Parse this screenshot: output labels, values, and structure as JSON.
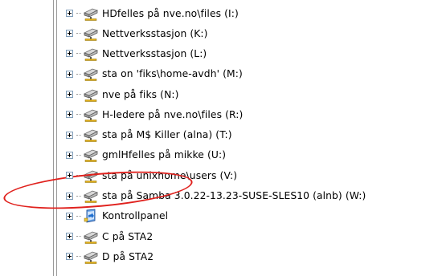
{
  "tree": {
    "items": [
      {
        "label": "HDfelles på nve.no\\files (I:)",
        "icon": "network-drive-icon"
      },
      {
        "label": "Nettverksstasjon (K:)",
        "icon": "network-drive-icon"
      },
      {
        "label": "Nettverksstasjon (L:)",
        "icon": "network-drive-icon"
      },
      {
        "label": "sta on 'fiks\\home-avdh' (M:)",
        "icon": "network-drive-icon"
      },
      {
        "label": "nve på fiks (N:)",
        "icon": "network-drive-icon"
      },
      {
        "label": "H-ledere på nve.no\\files (R:)",
        "icon": "network-drive-icon"
      },
      {
        "label": "sta på M$ Killer (alna) (T:)",
        "icon": "network-drive-icon"
      },
      {
        "label": "gmlHfelles på mikke (U:)",
        "icon": "network-drive-icon"
      },
      {
        "label": "sta på unixhome\\users (V:)",
        "icon": "network-drive-icon"
      },
      {
        "label": "sta på Samba 3.0.22-13.23-SUSE-SLES10 (alnb) (W:)",
        "icon": "network-drive-icon"
      },
      {
        "label": "Kontrollpanel",
        "icon": "control-panel-icon"
      },
      {
        "label": "C på STA2",
        "icon": "network-drive-icon"
      },
      {
        "label": "D på STA2",
        "icon": "network-drive-icon"
      }
    ]
  },
  "colors": {
    "highlight_ellipse": "#e0211d",
    "tree_lines": "#9c9c9c",
    "expander_border": "#7f9db9"
  }
}
